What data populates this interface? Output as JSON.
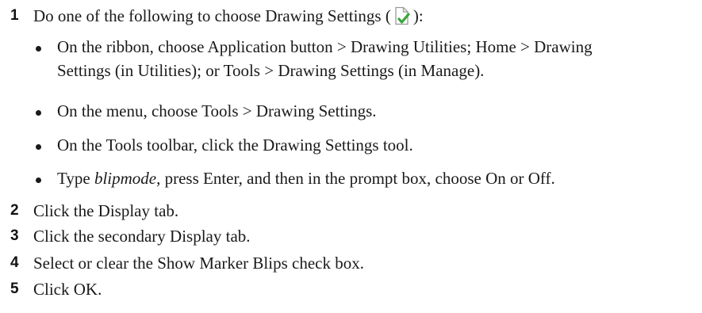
{
  "steps": [
    {
      "number": "1",
      "text_before_icon": "Do one of the following to choose Drawing Settings (",
      "icon": "drawing-settings-icon",
      "text_after_icon": "):"
    },
    {
      "number": "2",
      "text": "Click the Display tab."
    },
    {
      "number": "3",
      "text": "Click the secondary Display tab."
    },
    {
      "number": "4",
      "text": "Select or clear the Show Marker Blips check box."
    },
    {
      "number": "5",
      "text": "Click OK."
    }
  ],
  "bullets": [
    {
      "line1": "On the ribbon, choose Application button > Drawing Utilities; Home > Drawing",
      "line2": "Settings (in Utilities); or Tools > Drawing Settings (in Manage)."
    },
    {
      "text": "On the menu, choose Tools > Drawing Settings."
    },
    {
      "text": "On the Tools toolbar, click the Drawing Settings tool."
    },
    {
      "prefix": "Type ",
      "emphasis": "blipmode",
      "suffix": ", press Enter, and then in the prompt box, choose On or Off."
    }
  ],
  "colors": {
    "icon_check": "#3aa63a",
    "icon_page": "#9a9a9a"
  }
}
